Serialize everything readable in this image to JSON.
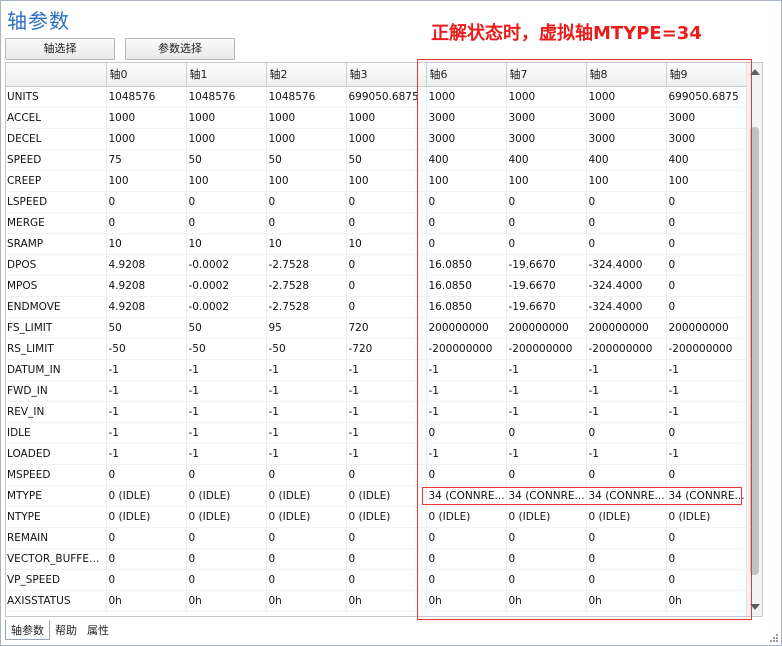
{
  "title": "轴参数",
  "annotation": "正解状态时，虚拟轴MTYPE=34",
  "buttons": {
    "axis_select": "轴选择",
    "param_select": "参数选择"
  },
  "columns": [
    "",
    "轴0",
    "轴1",
    "轴2",
    "轴3",
    "轴6",
    "轴7",
    "轴8",
    "轴9"
  ],
  "rows": [
    [
      "UNITS",
      "1048576",
      "1048576",
      "1048576",
      "699050.6875",
      "1000",
      "1000",
      "1000",
      "699050.6875"
    ],
    [
      "ACCEL",
      "1000",
      "1000",
      "1000",
      "1000",
      "3000",
      "3000",
      "3000",
      "3000"
    ],
    [
      "DECEL",
      "1000",
      "1000",
      "1000",
      "1000",
      "3000",
      "3000",
      "3000",
      "3000"
    ],
    [
      "SPEED",
      "75",
      "50",
      "50",
      "50",
      "400",
      "400",
      "400",
      "400"
    ],
    [
      "CREEP",
      "100",
      "100",
      "100",
      "100",
      "100",
      "100",
      "100",
      "100"
    ],
    [
      "LSPEED",
      "0",
      "0",
      "0",
      "0",
      "0",
      "0",
      "0",
      "0"
    ],
    [
      "MERGE",
      "0",
      "0",
      "0",
      "0",
      "0",
      "0",
      "0",
      "0"
    ],
    [
      "SRAMP",
      "10",
      "10",
      "10",
      "10",
      "0",
      "0",
      "0",
      "0"
    ],
    [
      "DPOS",
      "4.9208",
      "-0.0002",
      "-2.7528",
      "0",
      "16.0850",
      "-19.6670",
      "-324.4000",
      "0"
    ],
    [
      "MPOS",
      "4.9208",
      "-0.0002",
      "-2.7528",
      "0",
      "16.0850",
      "-19.6670",
      "-324.4000",
      "0"
    ],
    [
      "ENDMOVE",
      "4.9208",
      "-0.0002",
      "-2.7528",
      "0",
      "16.0850",
      "-19.6670",
      "-324.4000",
      "0"
    ],
    [
      "FS_LIMIT",
      "50",
      "50",
      "95",
      "720",
      "200000000",
      "200000000",
      "200000000",
      "200000000"
    ],
    [
      "RS_LIMIT",
      "-50",
      "-50",
      "-50",
      "-720",
      "-200000000",
      "-200000000",
      "-200000000",
      "-200000000"
    ],
    [
      "DATUM_IN",
      "-1",
      "-1",
      "-1",
      "-1",
      "-1",
      "-1",
      "-1",
      "-1"
    ],
    [
      "FWD_IN",
      "-1",
      "-1",
      "-1",
      "-1",
      "-1",
      "-1",
      "-1",
      "-1"
    ],
    [
      "REV_IN",
      "-1",
      "-1",
      "-1",
      "-1",
      "-1",
      "-1",
      "-1",
      "-1"
    ],
    [
      "IDLE",
      "-1",
      "-1",
      "-1",
      "-1",
      "0",
      "0",
      "0",
      "0"
    ],
    [
      "LOADED",
      "-1",
      "-1",
      "-1",
      "-1",
      "-1",
      "-1",
      "-1",
      "-1"
    ],
    [
      "MSPEED",
      "0",
      "0",
      "0",
      "0",
      "0",
      "0",
      "0",
      "0"
    ],
    [
      "MTYPE",
      "0 (IDLE)",
      "0 (IDLE)",
      "0 (IDLE)",
      "0 (IDLE)",
      "34 (CONNRE...",
      "34 (CONNRE...",
      "34 (CONNRE...",
      "34 (CONNRE..."
    ],
    [
      "NTYPE",
      "0 (IDLE)",
      "0 (IDLE)",
      "0 (IDLE)",
      "0 (IDLE)",
      "0 (IDLE)",
      "0 (IDLE)",
      "0 (IDLE)",
      "0 (IDLE)"
    ],
    [
      "REMAIN",
      "0",
      "0",
      "0",
      "0",
      "0",
      "0",
      "0",
      "0"
    ],
    [
      "VECTOR_BUFFERED",
      "0",
      "0",
      "0",
      "0",
      "0",
      "0",
      "0",
      "0"
    ],
    [
      "VP_SPEED",
      "0",
      "0",
      "0",
      "0",
      "0",
      "0",
      "0",
      "0"
    ],
    [
      "AXISSTATUS",
      "0h",
      "0h",
      "0h",
      "0h",
      "0h",
      "0h",
      "0h",
      "0h"
    ]
  ],
  "bottom_tabs": [
    "轴参数",
    "帮助",
    "属性"
  ],
  "colors": {
    "title": "#2b6fc2",
    "annotation": "#ea1c1c",
    "highlight_box": "#e33"
  }
}
